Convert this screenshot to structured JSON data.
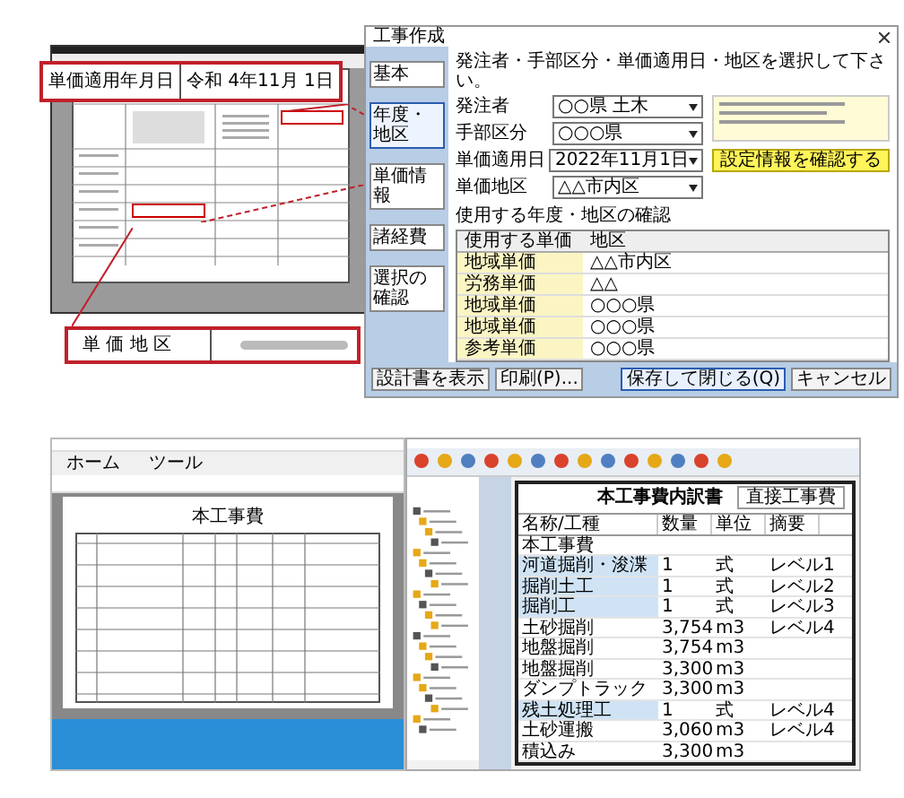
{
  "top_callout": {
    "label": "単価適用年月日",
    "value": "令和 4年11月 1日"
  },
  "bottom_callout": {
    "label": "単 価 地 区"
  },
  "dialog": {
    "title": "工事作成",
    "sidebar": [
      {
        "label": "基本",
        "selected": false
      },
      {
        "label": "年度・地区",
        "selected": true
      },
      {
        "label": "単価情報",
        "selected": false
      },
      {
        "label": "諸経費",
        "selected": false
      },
      {
        "label": "選択の確認",
        "selected": false
      }
    ],
    "instruction": "発注者・手部区分・単価適用日・地区を選択して下さい。",
    "fields": [
      {
        "label": "発注者",
        "value": "○○県 土木"
      },
      {
        "label": "手部区分",
        "value": "○○○県"
      },
      {
        "label": "単価適用日",
        "value": "2022年11月1日"
      },
      {
        "label": "単価地区",
        "value": "△△市内区"
      }
    ],
    "action_buttons": [
      {
        "label": "設定情報を確認する",
        "kind": "highlight"
      }
    ],
    "section": "使用する年度・地区の確認",
    "columns": [
      "使用する単価",
      "地区"
    ],
    "rows": [
      {
        "unit": "地域単価",
        "area": "△△市内区"
      },
      {
        "unit": "労務単価",
        "area": "△△"
      },
      {
        "unit": "地域単価",
        "area": "○○○県"
      },
      {
        "unit": "地域単価",
        "area": "○○○県"
      },
      {
        "unit": "参考単価",
        "area": "○○○県"
      }
    ],
    "footer_buttons": [
      {
        "label": "設計書を表示",
        "primary": false
      },
      {
        "label": "印刷(P)...",
        "primary": false
      },
      {
        "label": "保存して閉じる(Q)",
        "primary": true
      },
      {
        "label": "キャンセル",
        "primary": false
      }
    ]
  },
  "reader": {
    "tabs": [
      {
        "label": "ホーム",
        "selected": false
      },
      {
        "label": "ツール",
        "selected": false
      }
    ],
    "doc_title": "本工事費"
  },
  "estimate": {
    "title": "本工事費内訳書",
    "tag": "直接工事費",
    "columns": [
      "名称/工種",
      "数量",
      "単位",
      "摘要"
    ],
    "rows": [
      {
        "name": "本工事費",
        "qty": "",
        "unit": "",
        "note": ""
      },
      {
        "name": "河道掘削・浚渫",
        "qty": "1",
        "unit": "式",
        "note": "レベル1"
      },
      {
        "name": "掘削土工",
        "qty": "1",
        "unit": "式",
        "note": "レベル2"
      },
      {
        "name": "掘削工",
        "qty": "1",
        "unit": "式",
        "note": "レベル3"
      },
      {
        "name": "土砂掘削",
        "qty": "3,754",
        "unit": "m3",
        "note": "レベル4"
      },
      {
        "name": "地盤掘削",
        "qty": "3,754",
        "unit": "m3",
        "note": ""
      },
      {
        "name": "地盤掘削",
        "qty": "3,300",
        "unit": "m3",
        "note": ""
      },
      {
        "name": "ダンプトラック",
        "qty": "3,300",
        "unit": "m3",
        "note": ""
      },
      {
        "name": "残土処理工",
        "qty": "1",
        "unit": "式",
        "note": "レベル4"
      },
      {
        "name": "土砂運搬",
        "qty": "3,060",
        "unit": "m3",
        "note": "レベル4"
      },
      {
        "name": "積込み",
        "qty": "3,300",
        "unit": "m3",
        "note": ""
      }
    ]
  }
}
